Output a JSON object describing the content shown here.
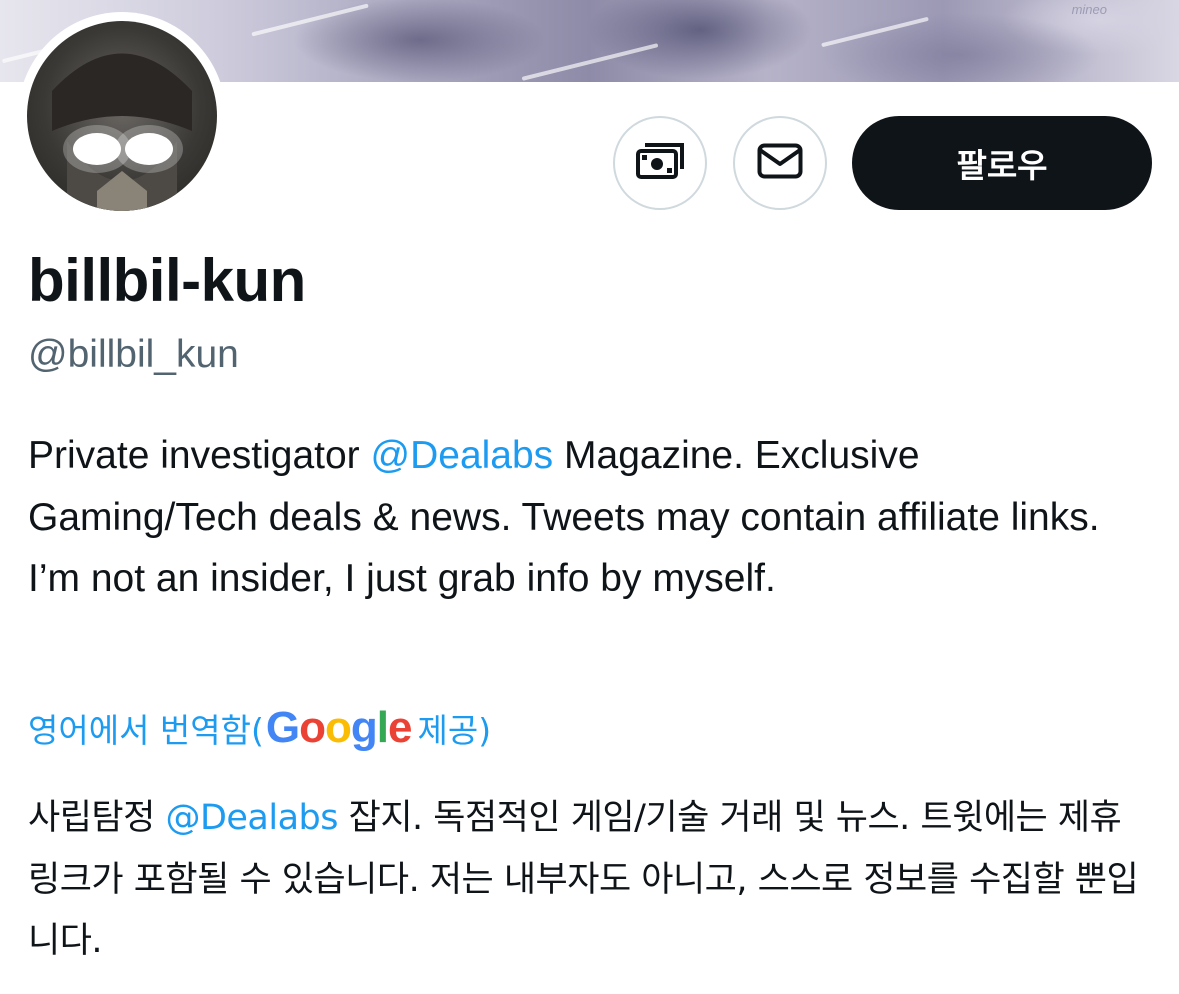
{
  "profile": {
    "display_name": "billbil-kun",
    "handle": "@billbil_kun",
    "follow_label": "팔로우",
    "bio": {
      "before_mention": "Private investigator ",
      "mention": "@Dealabs",
      "after_mention": " Magazine. Exclusive Gaming/Tech deals & news. Tweets may contain affiliate links. I’m not an insider, I just grab info by myself."
    },
    "translation": {
      "prefix": "영어에서 번역함(",
      "logo_letters": [
        "G",
        "o",
        "o",
        "g",
        "l",
        "e"
      ],
      "suffix": "제공)",
      "before_mention": "사립탐정 ",
      "mention": "@Dealabs",
      "after_mention": " 잡지. 독점적인 게임/기술 거래 및 뉴스. 트윗에는 제휴 링크가 포함될 수 있습니다. 저는 내부자도 아니고, 스스로 정보를 수집할 뿐입니다."
    }
  },
  "banner": {
    "signature": "mineo"
  },
  "icons": {
    "tip": "money-icon",
    "message": "envelope-icon"
  },
  "colors": {
    "link": "#1d9bf0",
    "text": "#0f1419",
    "muted": "#536471",
    "button_bg": "#0f1419",
    "border": "#cfd9de"
  }
}
